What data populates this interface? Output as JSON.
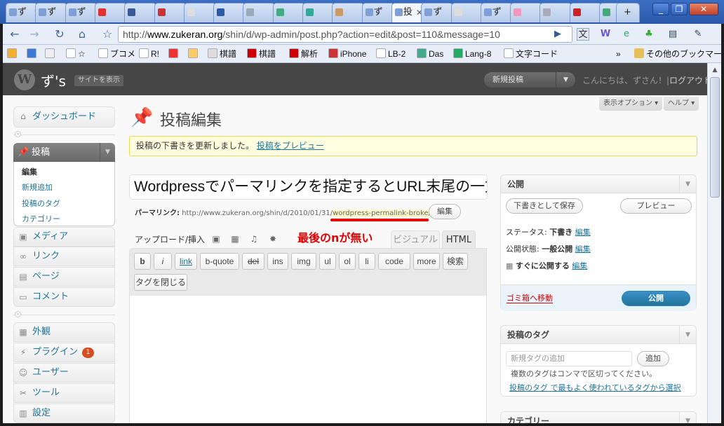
{
  "browser": {
    "tabs": [
      {
        "label": "ず"
      },
      {
        "label": "ず"
      },
      {
        "label": "ず"
      },
      {
        "label": ""
      },
      {
        "label": ""
      },
      {
        "label": ""
      },
      {
        "label": ""
      },
      {
        "label": ""
      },
      {
        "label": ""
      },
      {
        "label": ""
      },
      {
        "label": ""
      },
      {
        "label": ""
      },
      {
        "label": "ず"
      },
      {
        "label": "投",
        "active": true
      },
      {
        "label": "ず"
      },
      {
        "label": ""
      },
      {
        "label": "ず"
      },
      {
        "label": ""
      },
      {
        "label": ""
      },
      {
        "label": ""
      },
      {
        "label": ""
      }
    ],
    "url_prefix": "http://",
    "url_domain": "www.zukeran.org",
    "url_path": "/shin/d/wp-admin/post.php?action=edit&post=110&message=10",
    "bookmarks": [
      {
        "label": ""
      },
      {
        "label": ""
      },
      {
        "label": ""
      },
      {
        "label": "☆"
      },
      {
        "label": "ブコメ"
      },
      {
        "label": "R!"
      },
      {
        "label": ""
      },
      {
        "label": ""
      },
      {
        "label": "棋譜"
      },
      {
        "label": "棋譜"
      },
      {
        "label": "解析"
      },
      {
        "label": "iPhone"
      },
      {
        "label": "LB-2"
      },
      {
        "label": "Das"
      },
      {
        "label": "Lang-8"
      },
      {
        "label": "文字コード"
      }
    ],
    "bookmarks_more": "»",
    "other_bookmarks": "その他のブックマーク"
  },
  "wp": {
    "site_name": "ず's",
    "view_site": "サイトを表示",
    "new_post": "新規投稿",
    "howdy": "こんにちは、ずさん！|",
    "logout": "ログアウト",
    "screen_options": "表示オプション",
    "help": "ヘルプ",
    "menu": {
      "dashboard": "ダッシュボード",
      "posts": "投稿",
      "posts_sub": [
        "編集",
        "新規追加",
        "投稿のタグ",
        "カテゴリー"
      ],
      "media": "メディア",
      "links": "リンク",
      "pages": "ページ",
      "comments": "コメント",
      "appearance": "外観",
      "plugins": "プラグイン",
      "plugins_badge": "1",
      "users": "ユーザー",
      "tools": "ツール",
      "settings": "設定"
    },
    "page_title": "投稿編集",
    "notice_text": "投稿の下書きを更新しました。",
    "notice_link": "投稿をプレビュー",
    "post_title": "Wordpressでパーマリンクを指定するとURL末尾の一文",
    "permalink_label": "パーマリンク:",
    "permalink_base": "http://www.zukeran.org/shin/d/2010/01/31/",
    "permalink_slug": "wordpress-permalink-broke",
    "permalink_end": "/",
    "permalink_edit": "編集",
    "upload_label": "アップロード/挿入",
    "annotation": "最後のnが無い",
    "tab_visual": "ビジュアル",
    "tab_html": "HTML",
    "quicktags": [
      "b",
      "i",
      "link",
      "b-quote",
      "del",
      "ins",
      "img",
      "ul",
      "ol",
      "li",
      "code",
      "more",
      "検索"
    ],
    "close_tags": "タグを閉じる",
    "publish_box": {
      "title": "公開",
      "save_draft": "下書きとして保存",
      "preview": "プレビュー",
      "status_label": "ステータス:",
      "status_value": "下書き",
      "visibility_label": "公開状態:",
      "visibility_value": "一般公開",
      "schedule_value": "すぐに公開する",
      "edit": "編集",
      "trash": "ゴミ箱へ移動",
      "publish": "公開"
    },
    "tags_box": {
      "title": "投稿のタグ",
      "placeholder": "新規タグの追加",
      "add": "追加",
      "hint": "複数のタグはコンマで区切ってください。",
      "popular_link": "投稿のタグ で最もよく使われているタグから選択"
    },
    "categories_box_title": "カテゴリー"
  }
}
